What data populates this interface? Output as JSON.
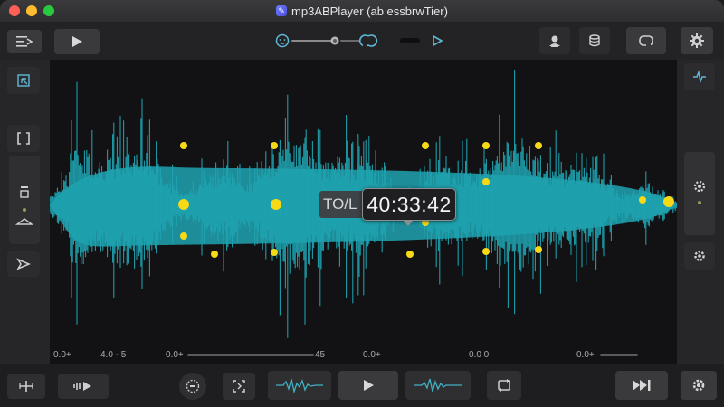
{
  "window": {
    "title": "mp3ABPlayer (ab essbrwTier)"
  },
  "toolbar": {
    "buttons": [
      "menu",
      "play",
      "profile",
      "database",
      "loop",
      "settings"
    ]
  },
  "transport": {
    "icons": [
      "face-icon",
      "knob-icon",
      "cycle-icon",
      "forward-icon"
    ]
  },
  "waveform": {
    "color": "#1fa3b0",
    "marker_color": "#f7d916",
    "current_time": "40:33:42",
    "label": "TO/L"
  },
  "ruler": {
    "ticks": [
      "0.0+",
      "4.0 - 5",
      "0.0+",
      "45",
      "0.0+",
      "0.0 0",
      "0.0+"
    ]
  },
  "bottombar": {
    "buttons": [
      "add",
      "wave-audio",
      "record",
      "crop",
      "waveform-a",
      "play",
      "waveform-b",
      "repeat",
      "skip-forward",
      "settings"
    ]
  }
}
